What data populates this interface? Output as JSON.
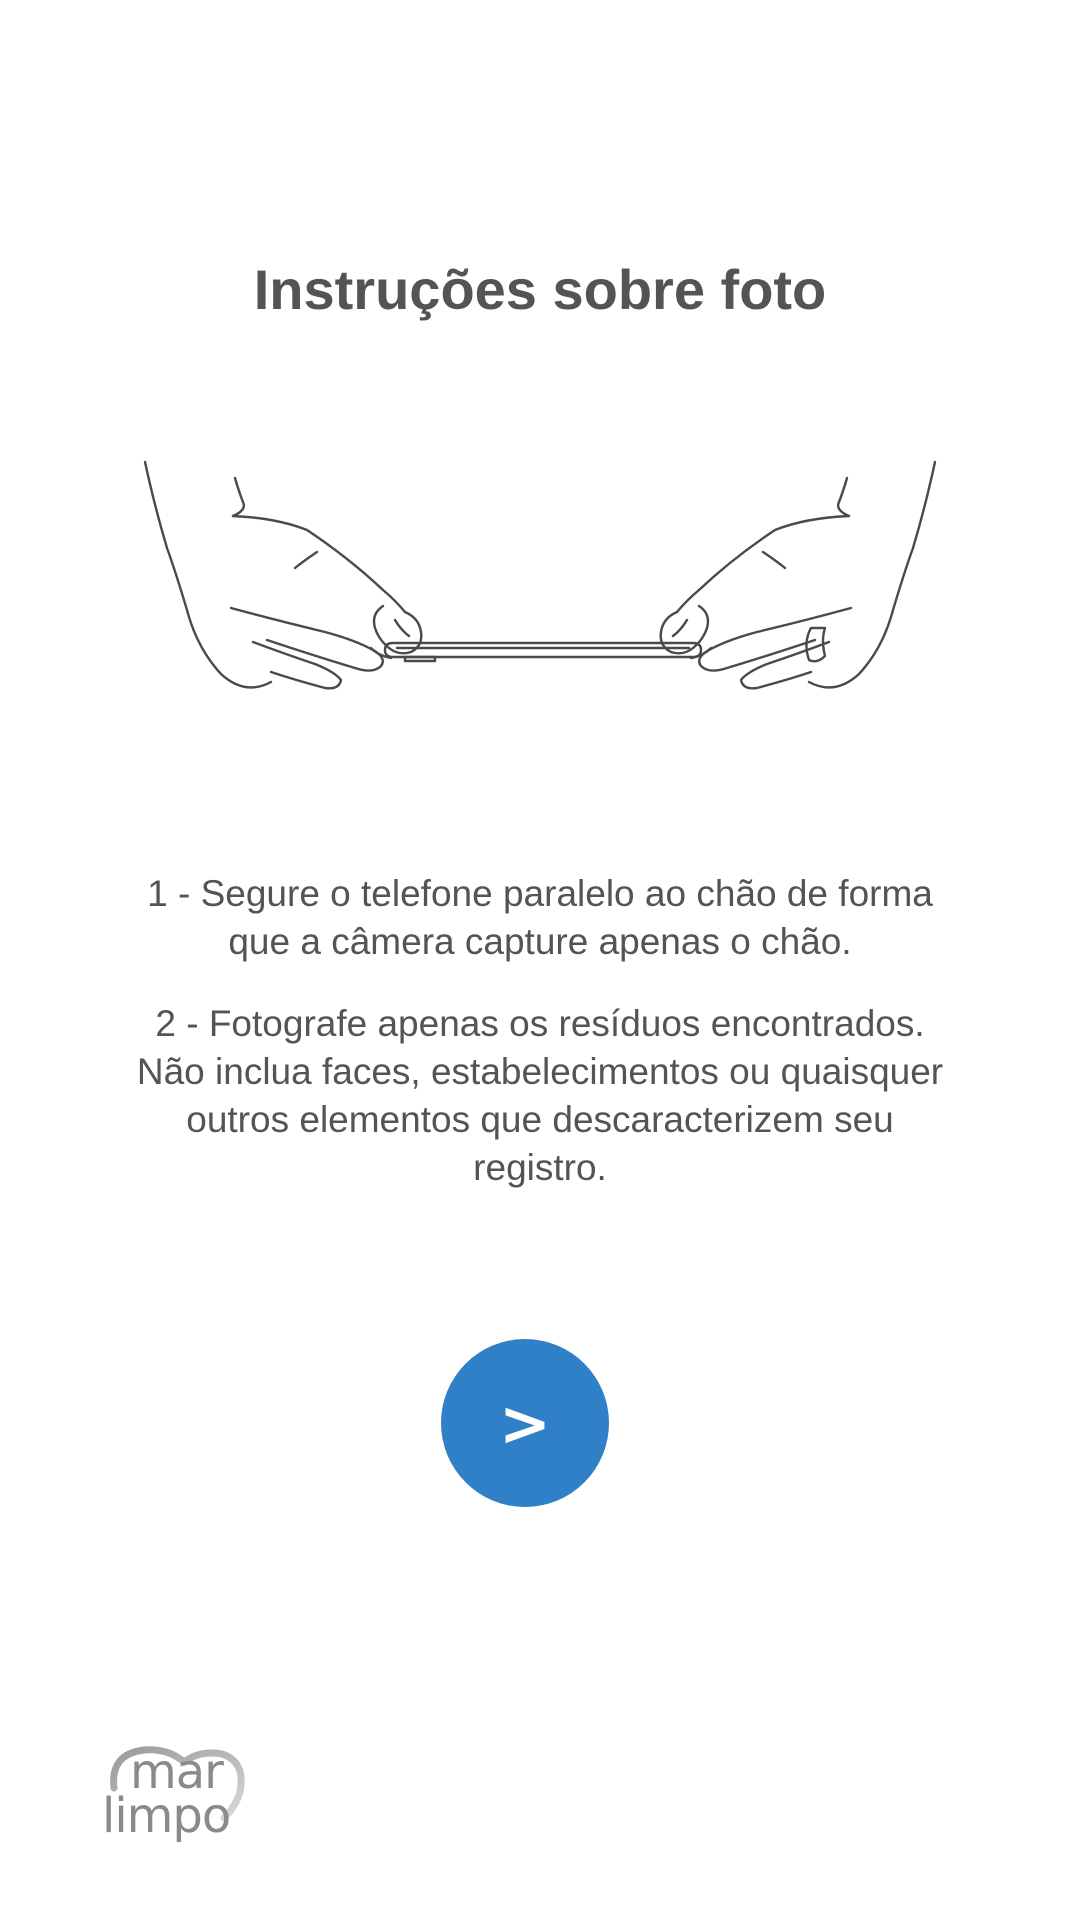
{
  "page": {
    "title": "Instruções sobre foto"
  },
  "instructions": [
    "1 - Segure o telefone paralelo ao chão de forma que a câmera capture apenas o chão.",
    "2 - Fotografe apenas os resíduos encontrados. Não inclua faces, estabelecimentos ou quaisquer outros elementos que descaracterizem seu registro."
  ],
  "next_button": {
    "label": ">",
    "color": "#2f80c6"
  },
  "logo": {
    "line1": "mar",
    "line2": "limpo"
  },
  "illustration": {
    "icon": "hands-holding-phone-flat-icon"
  }
}
